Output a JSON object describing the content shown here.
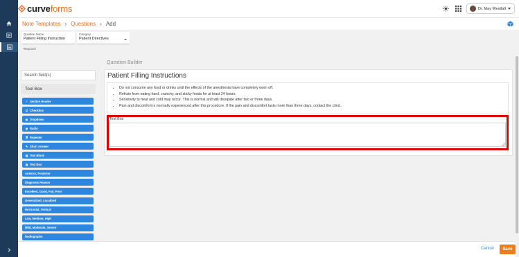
{
  "app": {
    "logo_part1": "curve",
    "logo_part2": "forms"
  },
  "header": {
    "user_name": "Dr. May Westfall"
  },
  "breadcrumb": [
    {
      "label": "Note Templates"
    },
    {
      "label": "Questions"
    },
    {
      "label": "Add"
    }
  ],
  "form": {
    "question_name": {
      "label": "Question Name",
      "value": "Patient Filling Instruction"
    },
    "category": {
      "label": "Category",
      "value": "Patient Directives"
    },
    "required_note": "*Required"
  },
  "toolbox": {
    "search_placeholder": "Search field(s)",
    "title": "Tool Box",
    "tools": [
      {
        "label": "Section Header",
        "icon": "section-header-icon",
        "glyph": "≡"
      },
      {
        "label": "Checkbox",
        "icon": "checkbox-icon",
        "glyph": "☑"
      },
      {
        "label": "Dropdown",
        "icon": "dropdown-icon",
        "glyph": "◉"
      },
      {
        "label": "Radio",
        "icon": "radio-icon",
        "glyph": "◉"
      },
      {
        "label": "Repeater",
        "icon": "repeater-icon",
        "glyph": "≣"
      },
      {
        "label": "Short Answer",
        "icon": "short-answer-icon",
        "glyph": "✎"
      },
      {
        "label": "Text Block",
        "icon": "text-block-icon",
        "glyph": "▤"
      },
      {
        "label": "Text Box",
        "icon": "text-box-icon",
        "glyph": "▤"
      },
      {
        "label": "Anterior, Posterior",
        "icon": "",
        "glyph": ""
      },
      {
        "label": "Diagnosis Reason",
        "icon": "",
        "glyph": ""
      },
      {
        "label": "Excellent, Good, Fair, Poor",
        "icon": "",
        "glyph": ""
      },
      {
        "label": "Generalized, Localized",
        "icon": "",
        "glyph": ""
      },
      {
        "label": "Horizontal, Vertical",
        "icon": "",
        "glyph": ""
      },
      {
        "label": "Low, Medium, High",
        "icon": "",
        "glyph": ""
      },
      {
        "label": "Mild, Moderate, Severe",
        "icon": "",
        "glyph": ""
      },
      {
        "label": "Radiographs",
        "icon": "",
        "glyph": ""
      }
    ]
  },
  "builder": {
    "section_label": "Question Builder",
    "title": "Patient Filling Instructions",
    "instructions": [
      "Do not consume any food or drinks until the effects of the anesthesia have completely worn off.",
      "Refrain from eating hard, crunchy, and sticky foods for at least 24 hours.",
      "Sensitivity to heat and cold may occur. This is normal and will dissipate after two or three days.",
      "Pain and discomfort is normally experienced after this procedure. If the pain and discomfort lasts more than three days, contact the clinic."
    ],
    "text_box_label": "Text Box",
    "highlight_color": "#e00000"
  },
  "footer": {
    "cancel_label": "Cancel",
    "save_label": "Save"
  },
  "colors": {
    "brand_orange": "#e9712a",
    "tool_blue": "#2f86de",
    "rail": "#1e3a5a",
    "save": "#f07d1a"
  }
}
